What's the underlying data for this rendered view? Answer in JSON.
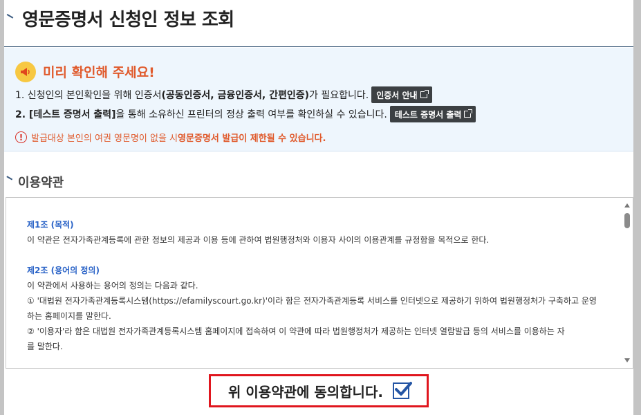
{
  "header": {
    "title": "영문증명서 신청인 정보 조회"
  },
  "notice": {
    "title": "미리 확인해 주세요!",
    "line1_prefix": "1. 신청인의 본인확인을 위해 인증서",
    "line1_bold": "(공동인증서, 금융인증서, 간편인증)",
    "line1_suffix": "가 필요합니다.",
    "cert_button": "인증서 안내",
    "line2_bold": "2. [테스트 증명서 출력]",
    "line2_suffix": "을 통해 소유하신 프린터의 정상 출력 여부를 확인하실 수 있습니다.",
    "test_button": "테스트 증명서 출력",
    "warning_prefix": "발급대상 본인의 여권 영문명이 없을 시 ",
    "warning_bold": "영문증명서 발급이 제한될 수 있습니다."
  },
  "terms": {
    "section_title": "이용약관",
    "article1_title": "제1조 (목적)",
    "article1_body": "이 약관은 전자가족관계등록에 관한 정보의 제공과 이용 등에 관하여 법원행정처와 이용자 사이의 이용관계를 규정함을 목적으로 한다.",
    "article2_title": "제2조 (용어의 정의)",
    "article2_intro": "이 약관에서 사용하는 용어의 정의는 다음과 같다.",
    "article2_item1_a": "① '대법원 전자가족관계등록시스템(https://efamilyscourt.go.kr)'이라 함은 전자가족관계등록 서비스를 인터넷으로 제공하기 위하여 법원행정처가 구축하고 운영",
    "article2_item1_b": "하는 홈페이지를 말한다.",
    "article2_item2_a": "② '이용자'라 함은 대법원 전자가족관계등록시스템 홈페이지에 접속하여 이 약관에 따라 법원행정처가 제공하는 인터넷 열람발급 등의 서비스를 이용하는 자",
    "article2_item2_b": "를 말한다."
  },
  "agree": {
    "label": "위 이용약관에 동의합니다.",
    "checked": true
  },
  "colors": {
    "accent_red": "#e0161e",
    "notice_title": "#e05a2c",
    "article_title": "#2a63c7",
    "checkbox": "#2455a4"
  }
}
